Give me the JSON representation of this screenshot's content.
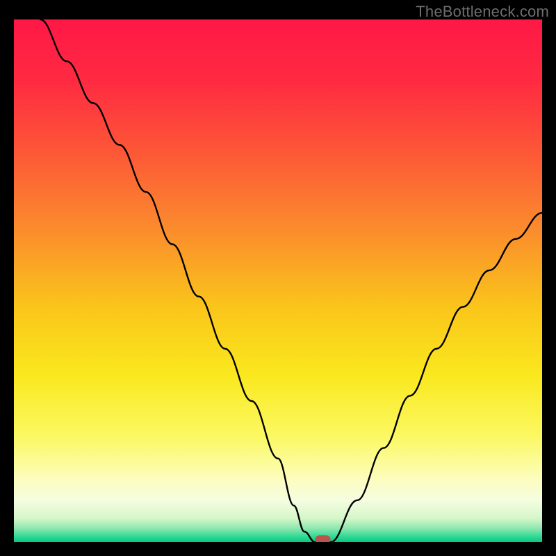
{
  "watermark": "TheBottleneck.com",
  "colors": {
    "gradient_stops": [
      {
        "offset": 0.0,
        "color": "#ff1846"
      },
      {
        "offset": 0.12,
        "color": "#ff2b41"
      },
      {
        "offset": 0.25,
        "color": "#fd5637"
      },
      {
        "offset": 0.4,
        "color": "#fb8b2d"
      },
      {
        "offset": 0.55,
        "color": "#fac51a"
      },
      {
        "offset": 0.68,
        "color": "#fae81e"
      },
      {
        "offset": 0.8,
        "color": "#fbf964"
      },
      {
        "offset": 0.88,
        "color": "#fcfdbf"
      },
      {
        "offset": 0.92,
        "color": "#f5fde0"
      },
      {
        "offset": 0.955,
        "color": "#d5f6c9"
      },
      {
        "offset": 0.975,
        "color": "#87e6ad"
      },
      {
        "offset": 0.99,
        "color": "#2dd894"
      },
      {
        "offset": 1.0,
        "color": "#08c77f"
      }
    ],
    "curve": "#000000",
    "marker": "#b9554e",
    "frame": "#000000"
  },
  "chart_data": {
    "type": "line",
    "title": "",
    "xlabel": "",
    "ylabel": "",
    "xlim": [
      0,
      100
    ],
    "ylim": [
      0,
      100
    ],
    "grid": false,
    "legend_position": "none",
    "axes_visible": false,
    "series": [
      {
        "name": "bottleneck-curve",
        "x": [
          5,
          10,
          15,
          20,
          25,
          30,
          35,
          40,
          45,
          50,
          53,
          55,
          57,
          60,
          65,
          70,
          75,
          80,
          85,
          90,
          95,
          100
        ],
        "y": [
          100,
          92,
          84,
          76,
          67,
          57,
          47,
          37,
          27,
          16,
          7,
          2,
          0,
          0,
          8,
          18,
          28,
          37,
          45,
          52,
          58,
          63
        ]
      }
    ],
    "marker": {
      "x": 58.5,
      "y": 0.5
    },
    "notes": "Background is a vertical gradient from red (top) through orange/yellow to green (bottom). Chart has no visible axes, ticks, or labels other than the watermark. Values are read off by position within the plot area where (0,0) is bottom-left and (100,100) is top-right."
  }
}
